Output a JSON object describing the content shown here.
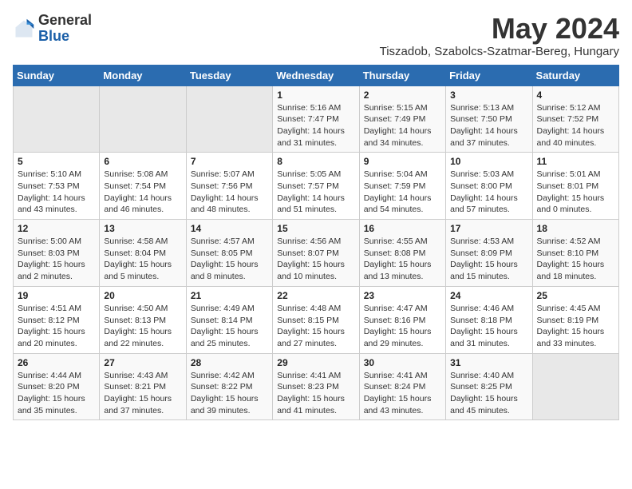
{
  "logo": {
    "general": "General",
    "blue": "Blue"
  },
  "title": "May 2024",
  "subtitle": "Tiszadob, Szabolcs-Szatmar-Bereg, Hungary",
  "headers": [
    "Sunday",
    "Monday",
    "Tuesday",
    "Wednesday",
    "Thursday",
    "Friday",
    "Saturday"
  ],
  "weeks": [
    [
      {
        "day": "",
        "info": ""
      },
      {
        "day": "",
        "info": ""
      },
      {
        "day": "",
        "info": ""
      },
      {
        "day": "1",
        "info": "Sunrise: 5:16 AM\nSunset: 7:47 PM\nDaylight: 14 hours\nand 31 minutes."
      },
      {
        "day": "2",
        "info": "Sunrise: 5:15 AM\nSunset: 7:49 PM\nDaylight: 14 hours\nand 34 minutes."
      },
      {
        "day": "3",
        "info": "Sunrise: 5:13 AM\nSunset: 7:50 PM\nDaylight: 14 hours\nand 37 minutes."
      },
      {
        "day": "4",
        "info": "Sunrise: 5:12 AM\nSunset: 7:52 PM\nDaylight: 14 hours\nand 40 minutes."
      }
    ],
    [
      {
        "day": "5",
        "info": "Sunrise: 5:10 AM\nSunset: 7:53 PM\nDaylight: 14 hours\nand 43 minutes."
      },
      {
        "day": "6",
        "info": "Sunrise: 5:08 AM\nSunset: 7:54 PM\nDaylight: 14 hours\nand 46 minutes."
      },
      {
        "day": "7",
        "info": "Sunrise: 5:07 AM\nSunset: 7:56 PM\nDaylight: 14 hours\nand 48 minutes."
      },
      {
        "day": "8",
        "info": "Sunrise: 5:05 AM\nSunset: 7:57 PM\nDaylight: 14 hours\nand 51 minutes."
      },
      {
        "day": "9",
        "info": "Sunrise: 5:04 AM\nSunset: 7:59 PM\nDaylight: 14 hours\nand 54 minutes."
      },
      {
        "day": "10",
        "info": "Sunrise: 5:03 AM\nSunset: 8:00 PM\nDaylight: 14 hours\nand 57 minutes."
      },
      {
        "day": "11",
        "info": "Sunrise: 5:01 AM\nSunset: 8:01 PM\nDaylight: 15 hours\nand 0 minutes."
      }
    ],
    [
      {
        "day": "12",
        "info": "Sunrise: 5:00 AM\nSunset: 8:03 PM\nDaylight: 15 hours\nand 2 minutes."
      },
      {
        "day": "13",
        "info": "Sunrise: 4:58 AM\nSunset: 8:04 PM\nDaylight: 15 hours\nand 5 minutes."
      },
      {
        "day": "14",
        "info": "Sunrise: 4:57 AM\nSunset: 8:05 PM\nDaylight: 15 hours\nand 8 minutes."
      },
      {
        "day": "15",
        "info": "Sunrise: 4:56 AM\nSunset: 8:07 PM\nDaylight: 15 hours\nand 10 minutes."
      },
      {
        "day": "16",
        "info": "Sunrise: 4:55 AM\nSunset: 8:08 PM\nDaylight: 15 hours\nand 13 minutes."
      },
      {
        "day": "17",
        "info": "Sunrise: 4:53 AM\nSunset: 8:09 PM\nDaylight: 15 hours\nand 15 minutes."
      },
      {
        "day": "18",
        "info": "Sunrise: 4:52 AM\nSunset: 8:10 PM\nDaylight: 15 hours\nand 18 minutes."
      }
    ],
    [
      {
        "day": "19",
        "info": "Sunrise: 4:51 AM\nSunset: 8:12 PM\nDaylight: 15 hours\nand 20 minutes."
      },
      {
        "day": "20",
        "info": "Sunrise: 4:50 AM\nSunset: 8:13 PM\nDaylight: 15 hours\nand 22 minutes."
      },
      {
        "day": "21",
        "info": "Sunrise: 4:49 AM\nSunset: 8:14 PM\nDaylight: 15 hours\nand 25 minutes."
      },
      {
        "day": "22",
        "info": "Sunrise: 4:48 AM\nSunset: 8:15 PM\nDaylight: 15 hours\nand 27 minutes."
      },
      {
        "day": "23",
        "info": "Sunrise: 4:47 AM\nSunset: 8:16 PM\nDaylight: 15 hours\nand 29 minutes."
      },
      {
        "day": "24",
        "info": "Sunrise: 4:46 AM\nSunset: 8:18 PM\nDaylight: 15 hours\nand 31 minutes."
      },
      {
        "day": "25",
        "info": "Sunrise: 4:45 AM\nSunset: 8:19 PM\nDaylight: 15 hours\nand 33 minutes."
      }
    ],
    [
      {
        "day": "26",
        "info": "Sunrise: 4:44 AM\nSunset: 8:20 PM\nDaylight: 15 hours\nand 35 minutes."
      },
      {
        "day": "27",
        "info": "Sunrise: 4:43 AM\nSunset: 8:21 PM\nDaylight: 15 hours\nand 37 minutes."
      },
      {
        "day": "28",
        "info": "Sunrise: 4:42 AM\nSunset: 8:22 PM\nDaylight: 15 hours\nand 39 minutes."
      },
      {
        "day": "29",
        "info": "Sunrise: 4:41 AM\nSunset: 8:23 PM\nDaylight: 15 hours\nand 41 minutes."
      },
      {
        "day": "30",
        "info": "Sunrise: 4:41 AM\nSunset: 8:24 PM\nDaylight: 15 hours\nand 43 minutes."
      },
      {
        "day": "31",
        "info": "Sunrise: 4:40 AM\nSunset: 8:25 PM\nDaylight: 15 hours\nand 45 minutes."
      },
      {
        "day": "",
        "info": ""
      }
    ]
  ]
}
